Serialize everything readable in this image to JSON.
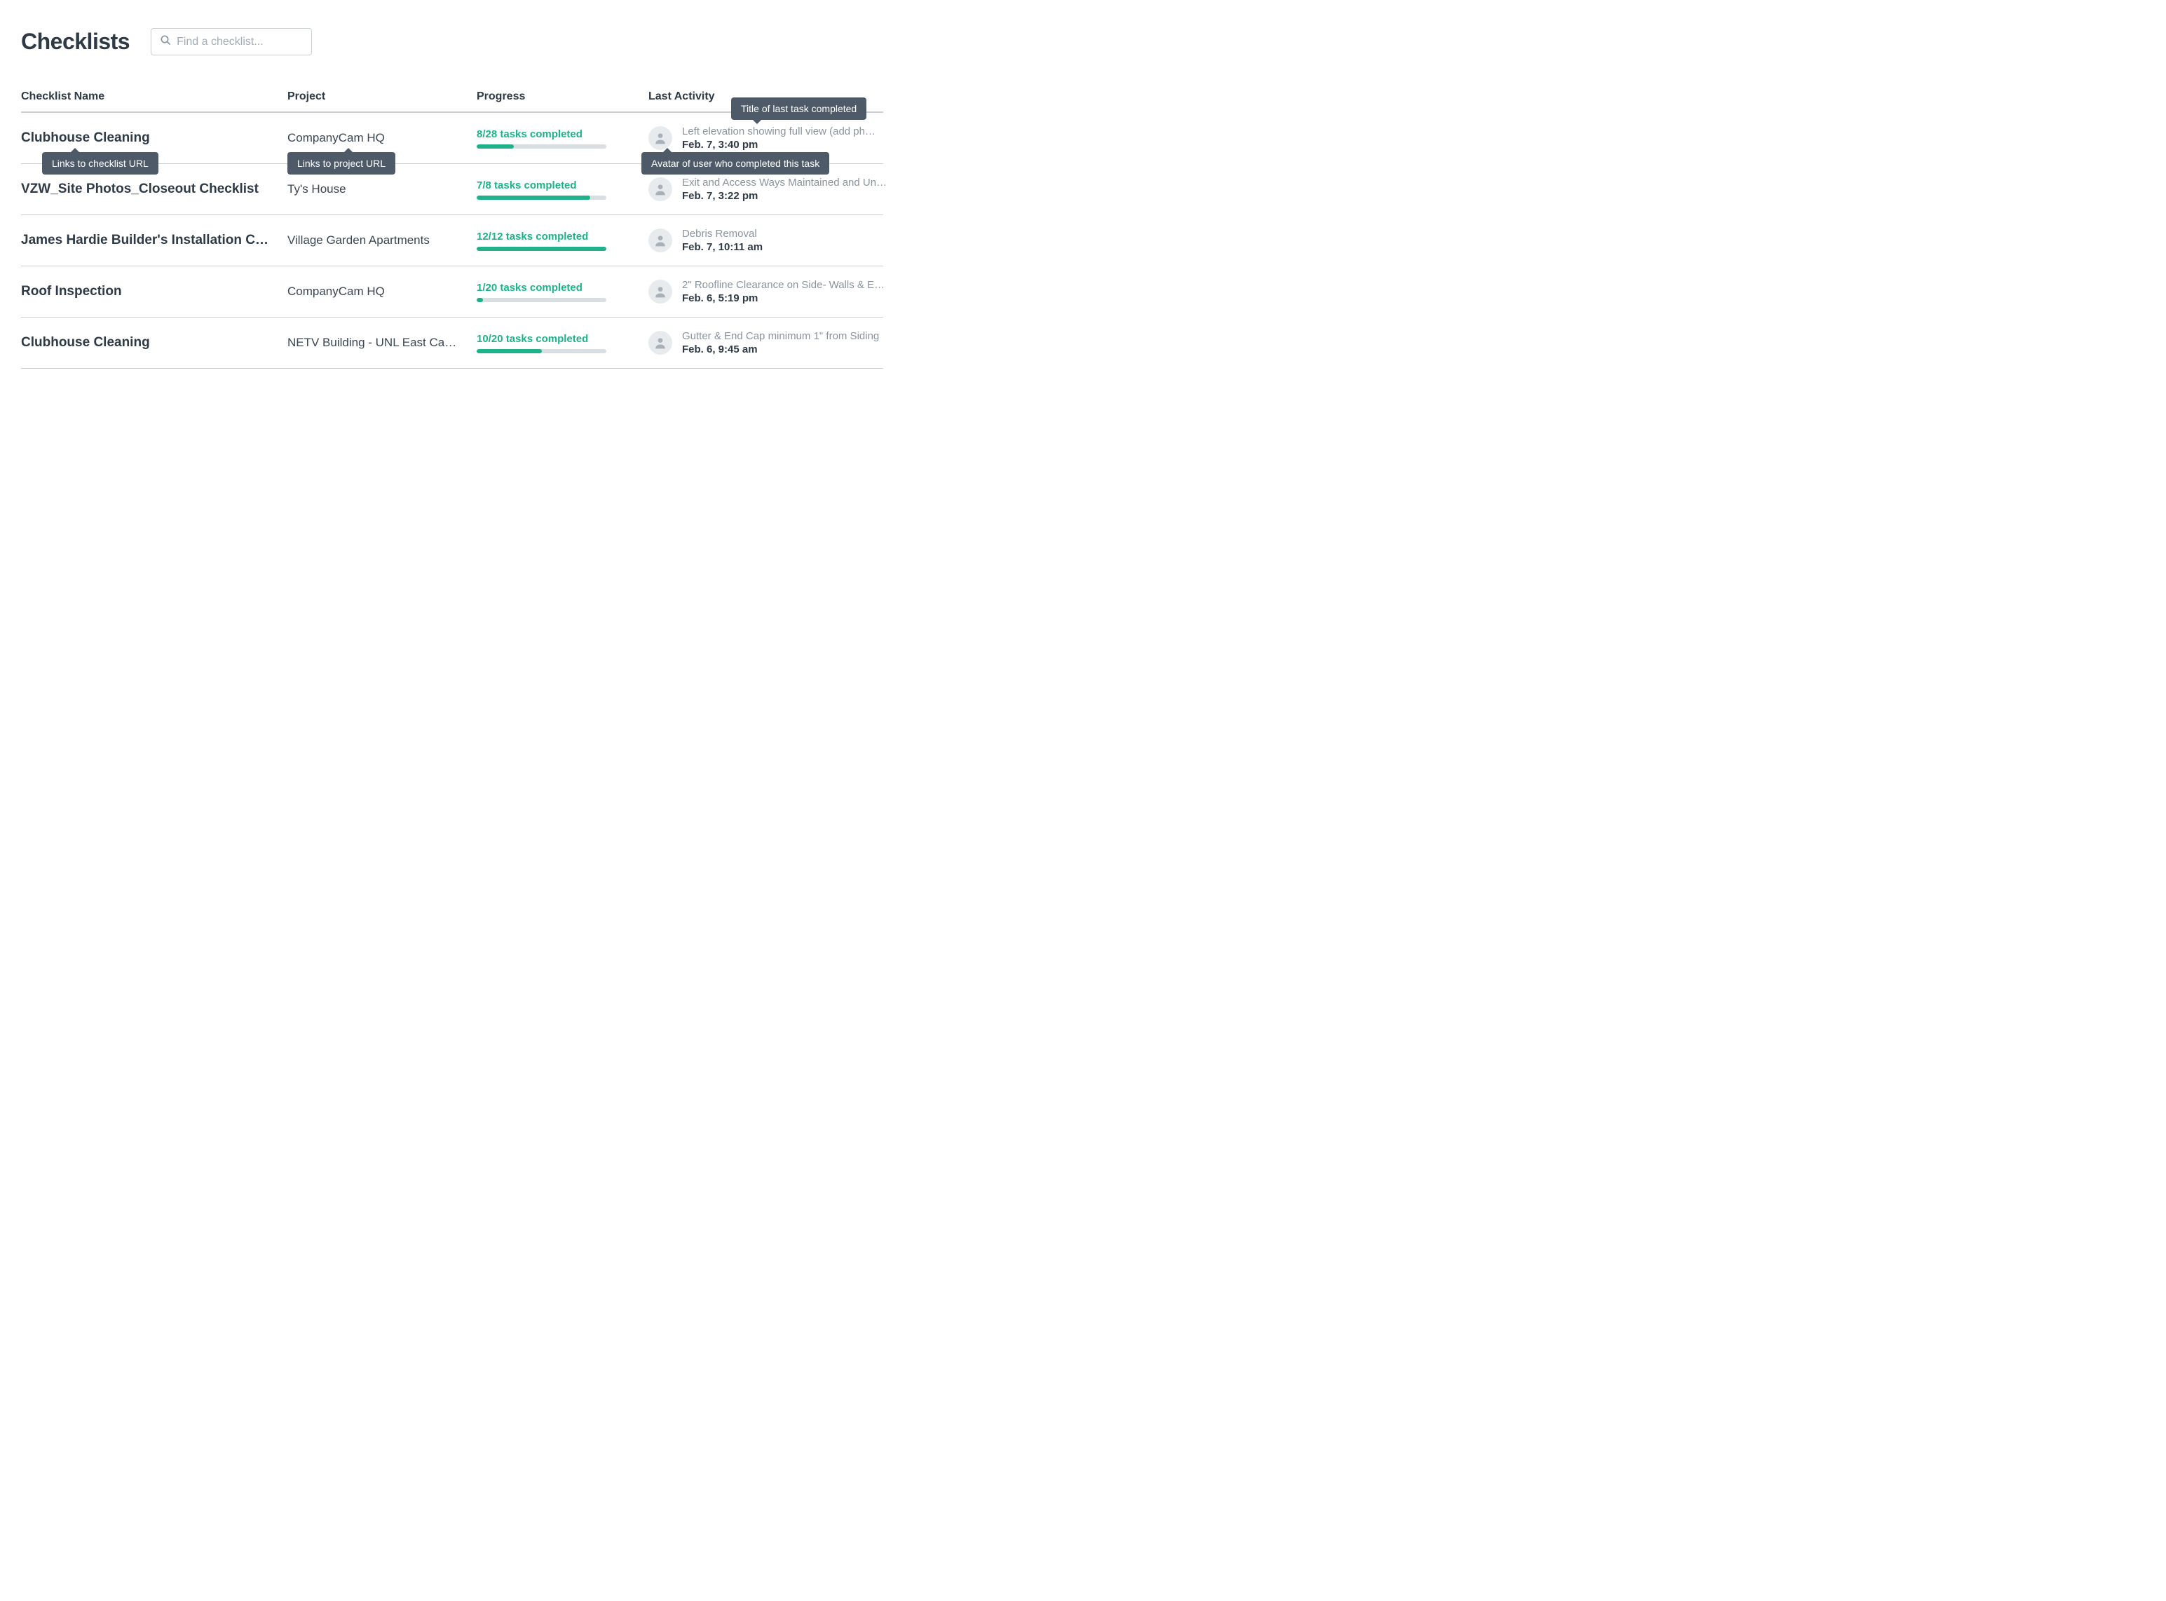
{
  "page_title": "Checklists",
  "search": {
    "placeholder": "Find a checklist..."
  },
  "columns": {
    "name": "Checklist Name",
    "project": "Project",
    "progress": "Progress",
    "activity": "Last Activity"
  },
  "tooltips": {
    "checklist_link": "Links to checklist URL",
    "project_link": "Links to project URL",
    "avatar": "Avatar of user who completed this task",
    "task_title": "Title of last task completed"
  },
  "rows": [
    {
      "name": "Clubhouse Cleaning",
      "project": "CompanyCam HQ",
      "progress_text": "8/28 tasks completed",
      "progress_pct": 28.6,
      "task": "Left elevation showing full view (add ph…",
      "date": "Feb. 7, 3:40 pm"
    },
    {
      "name": "VZW_Site Photos_Closeout Checklist",
      "project": "Ty's House",
      "progress_text": "7/8 tasks completed",
      "progress_pct": 87.5,
      "task": "Exit and Access Ways Maintained and Un…",
      "date": "Feb. 7, 3:22 pm"
    },
    {
      "name": "James Hardie Builder's Installation C…",
      "project": "Village Garden Apartments",
      "progress_text": "12/12 tasks completed",
      "progress_pct": 100,
      "task": "Debris Removal",
      "date": "Feb. 7, 10:11 am"
    },
    {
      "name": "Roof Inspection",
      "project": "CompanyCam HQ",
      "progress_text": "1/20 tasks completed",
      "progress_pct": 5,
      "task": "2\" Roofline Clearance on Side- Walls & E…",
      "date": "Feb. 6, 5:19 pm"
    },
    {
      "name": "Clubhouse Cleaning",
      "project": "NETV Building - UNL East Cam…",
      "progress_text": "10/20 tasks completed",
      "progress_pct": 50,
      "task": "Gutter & End Cap minimum 1\" from Siding",
      "date": "Feb. 6, 9:45 am"
    }
  ]
}
